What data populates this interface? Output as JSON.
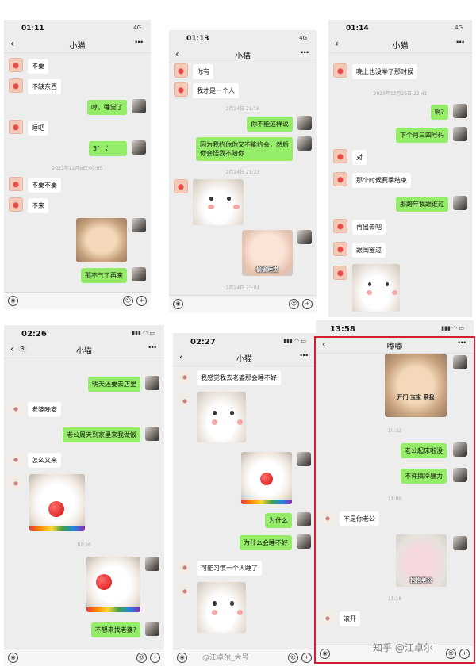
{
  "panel1": {
    "time": "01:11",
    "signal": "4G",
    "title": "小猫",
    "messages": [
      {
        "side": "l",
        "text": "不要"
      },
      {
        "side": "l",
        "text": "不缺东西"
      },
      {
        "side": "r",
        "text": "哼，睡觉了"
      },
      {
        "side": "l",
        "text": "睡吧"
      },
      {
        "side": "r",
        "text": "3\" 〈"
      },
      {
        "side": "l",
        "text": "不要不要"
      },
      {
        "side": "l",
        "text": "不来"
      },
      {
        "side": "r",
        "text": "那不气了再来"
      }
    ],
    "timestamp": "2023年12月8日 01:05"
  },
  "panel2": {
    "time": "01:13",
    "signal": "4G",
    "title": "小猫",
    "messages": [
      {
        "side": "l",
        "text": "你有"
      },
      {
        "side": "l",
        "text": "我才是一个人"
      },
      {
        "side": "r",
        "text": "你不能这样说"
      },
      {
        "side": "r",
        "text": "因为我约你你又不能约会，然后"
      },
      {
        "side": "r",
        "text": "你会怪我不陪你"
      }
    ],
    "timestamps": [
      "2月24日 21:16",
      "2月24日 21:23",
      "2月24日 23:01"
    ],
    "sticker_caption": "偷偷睡觉"
  },
  "panel3": {
    "time": "01:14",
    "signal": "4G",
    "title": "小猫",
    "messages": [
      {
        "side": "l",
        "text": "晚上也没举了那时候"
      },
      {
        "side": "r",
        "text": "啊?"
      },
      {
        "side": "r",
        "text": "下个月三四号码"
      },
      {
        "side": "l",
        "text": "对"
      },
      {
        "side": "l",
        "text": "那个时候赛季结束"
      },
      {
        "side": "r",
        "text": "那跨年我跟谁过"
      },
      {
        "side": "l",
        "text": "再出去吧"
      },
      {
        "side": "l",
        "text": "跟闺蜜过"
      }
    ],
    "timestamp": "2023年12月25日 22:41"
  },
  "panel4": {
    "time": "02:26",
    "title": "小猫",
    "badge": "3",
    "messages": [
      {
        "side": "r",
        "text": "明天还要去店里"
      },
      {
        "side": "l",
        "text": "老婆晚安"
      },
      {
        "side": "r",
        "text": "老公周天到家里来我做饭"
      },
      {
        "side": "l",
        "text": "怎么又来"
      },
      {
        "side": "r",
        "text": "不想来找老婆?"
      }
    ],
    "timestamp": "02:26"
  },
  "panel5": {
    "time": "02:27",
    "title": "小猫",
    "messages": [
      {
        "side": "l",
        "text": "我感觉我去老婆那会睡不好"
      },
      {
        "side": "r",
        "text": "为什么"
      },
      {
        "side": "r",
        "text": "为什么会睡不好"
      },
      {
        "side": "l",
        "text": "可能习惯一个人睡了"
      }
    ]
  },
  "panel6": {
    "time": "13:58",
    "title": "嘟嘟",
    "messages": [
      {
        "side": "r",
        "text": "老公起床啦没"
      },
      {
        "side": "r",
        "text": "不许搞冷暴力"
      },
      {
        "side": "l",
        "text": "不是你老公"
      },
      {
        "side": "l",
        "text": "滚开"
      }
    ],
    "timestamps": [
      "10:32",
      "11:00",
      "11:18"
    ],
    "sticker_caption_top": "开门 宝宝 系我",
    "sticker_caption_bottom": "抱抱老公"
  },
  "watermarks": {
    "zhihu": "知乎 @江卓尔",
    "weibo": "@江卓尔_大号"
  },
  "colors": {
    "sent_bubble": "#95ec69",
    "received_bubble": "#ffffff",
    "chat_bg": "#ededed",
    "highlight_border": "#d21f2f"
  }
}
